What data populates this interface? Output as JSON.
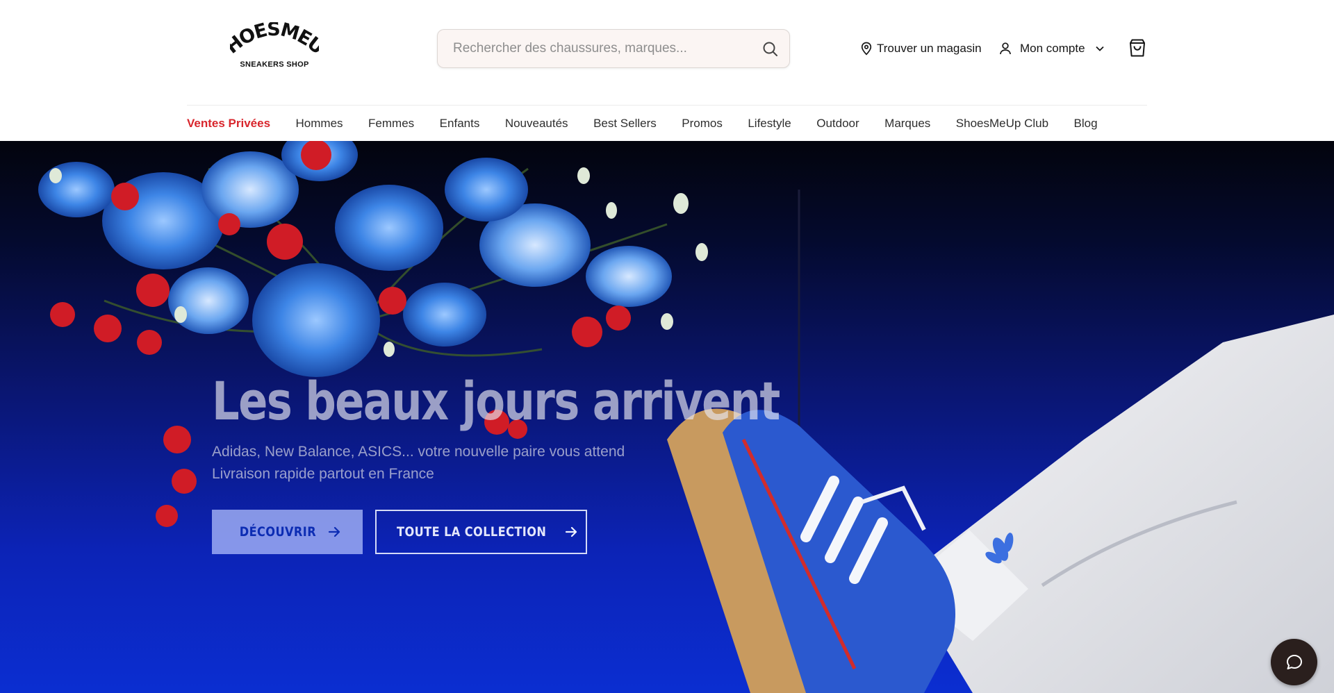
{
  "brand": {
    "logo_text": "SHOESMEUP",
    "tagline": "SNEAKERS SHOP"
  },
  "search": {
    "placeholder": "Rechercher des chaussures, marques..."
  },
  "header": {
    "store_label": "Trouver un magasin",
    "account_label": "Mon compte"
  },
  "nav": {
    "items": [
      {
        "label": "Ventes Privées",
        "highlight": true
      },
      {
        "label": "Hommes"
      },
      {
        "label": "Femmes"
      },
      {
        "label": "Enfants"
      },
      {
        "label": "Nouveautés"
      },
      {
        "label": "Best Sellers"
      },
      {
        "label": "Promos"
      },
      {
        "label": "Lifestyle"
      },
      {
        "label": "Outdoor"
      },
      {
        "label": "Marques"
      },
      {
        "label": "ShoesMeUp Club"
      },
      {
        "label": "Blog"
      }
    ]
  },
  "hero": {
    "title": "Les beaux jours arrivent",
    "subtitle_line1": "Adidas, New Balance, ASICS... votre nouvelle paire vous attend",
    "subtitle_line2": "Livraison rapide partout en France",
    "primary_cta": "DÉCOUVRIR",
    "secondary_cta": "TOUTE LA COLLECTION"
  },
  "icons": {
    "search": "search-icon",
    "store": "map-pin-icon",
    "account": "user-icon",
    "account_toggle": "chevron-down-icon",
    "cart": "shopping-bag-icon",
    "arrow": "arrow-right-icon",
    "chat": "chat-bubble-icon"
  },
  "colors": {
    "accent_red": "#d8262d",
    "hero_blue": "#0b2ed1",
    "chat_bg": "#2a1f1d"
  }
}
